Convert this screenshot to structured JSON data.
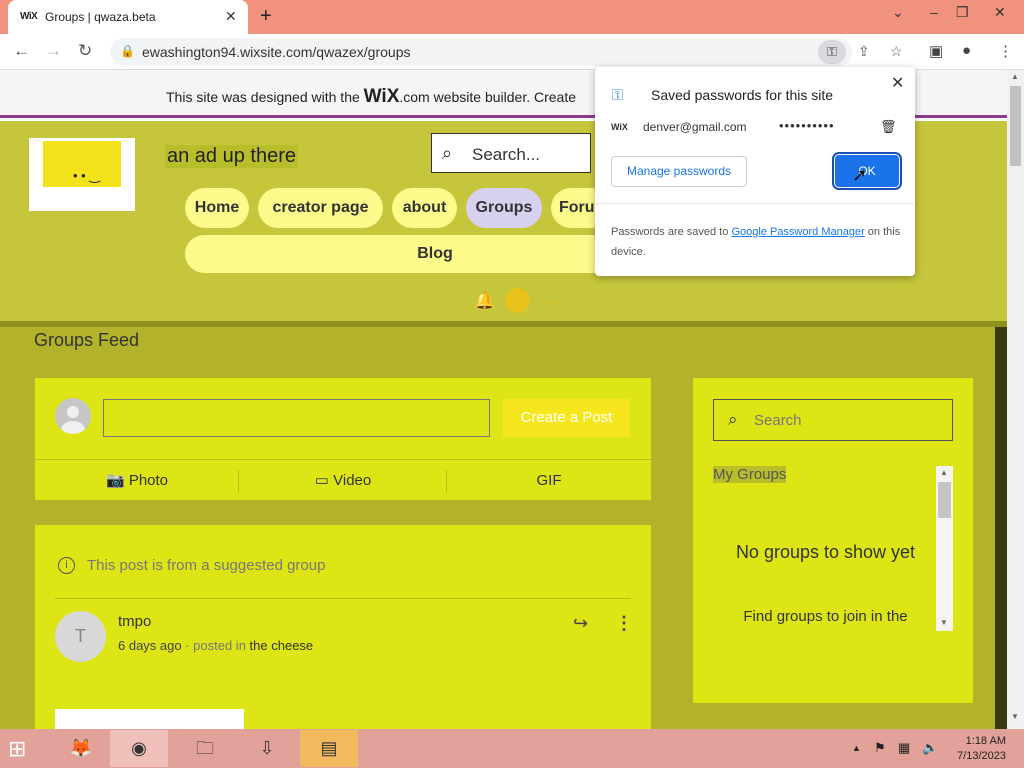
{
  "browser": {
    "tab": {
      "favicon": "WiX",
      "title": "Groups | qwaza.beta",
      "close": "✕"
    },
    "new_tab": "+",
    "window": {
      "chevron": "⌄",
      "minimize": "–",
      "restore": "❐",
      "close": "✕"
    },
    "nav": {
      "back": "←",
      "forward": "→",
      "reload": "↻"
    },
    "omnibox": {
      "lock": "🔒",
      "url": "ewashington94.wixsite.com/qwazex/groups"
    },
    "toolbar_icons": {
      "key": "⚿",
      "share": "⇪",
      "star": "☆",
      "sidebar": "▣",
      "profile": "●",
      "menu": "⋮"
    }
  },
  "wix_banner": {
    "text_before": "This site was designed with the ",
    "brand": "WiX",
    "text_after": ".com website builder. Create"
  },
  "site": {
    "ad_text": "an ad up there",
    "search_placeholder": "Search...",
    "nav": [
      "Home",
      "creator page",
      "about",
      "Groups",
      "Foru"
    ],
    "blog": "Blog",
    "logo_face": "• •  ‿"
  },
  "feed": {
    "title": "Groups Feed",
    "create_post": "Create a Post",
    "actions": {
      "photo": "Photo",
      "video": "Video",
      "gif": "GIF"
    },
    "post": {
      "suggested": "This post is from a suggested group",
      "avatar_letter": "T",
      "author": "tmpo",
      "time": "6 days ago",
      "posted_in": " · posted in ",
      "group": "the cheese"
    }
  },
  "sidebar": {
    "search_placeholder": "Search",
    "my_groups": "My Groups",
    "empty_title": "No groups to show yet",
    "empty_sub": "Find groups to join in the"
  },
  "password_popup": {
    "title": "Saved passwords for this site",
    "site_icon": "WiX",
    "username": "denver@gmail.com",
    "password_mask": "••••••••••",
    "manage_label": "Manage passwords",
    "ok_label": "OK",
    "footer_before": "Passwords are saved to ",
    "footer_link": "Google Password Manager",
    "footer_after": " on this device."
  },
  "taskbar": {
    "start": "⊞",
    "time": "1:18 AM",
    "date": "7/13/2023"
  },
  "colors": {
    "site_bg": "#c5c63b",
    "panel_bg": "#dde614",
    "nav_pill": "#fdfa8c",
    "active_pill": "#d6d1ee",
    "title_bar": "#f0927e",
    "taskbar": "#e2a29a",
    "accent_blue": "#1a73e8"
  }
}
